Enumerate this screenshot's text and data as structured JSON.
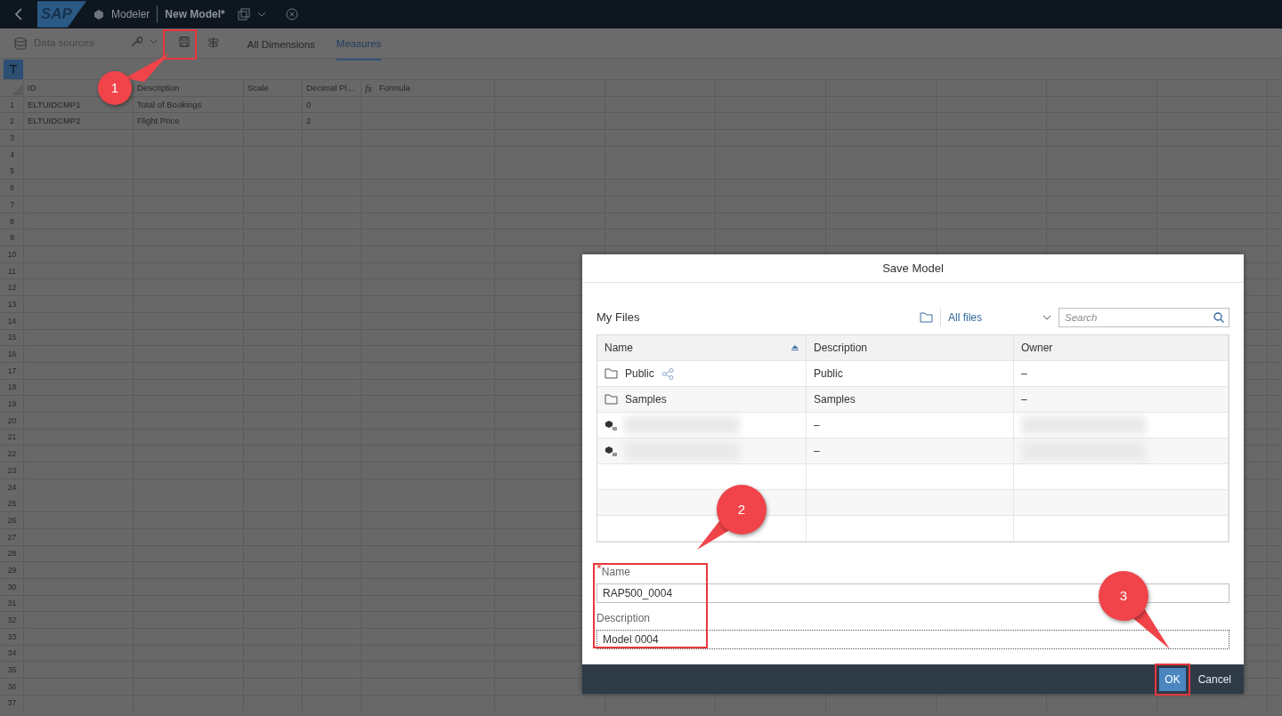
{
  "shell": {
    "logo": "SAP",
    "app": "Modeler",
    "document": "New Model*"
  },
  "toolbar": {
    "data_sources": {
      "label": "Data sources",
      "disabled": true
    },
    "tabs": [
      {
        "label": "All Dimensions",
        "selected": false
      },
      {
        "label": "Measures",
        "selected": true
      }
    ]
  },
  "grid": {
    "formula_button": "T",
    "formula_icon": "fx",
    "columns": [
      "ID",
      "Description",
      "Scale",
      "Decimal Pl...",
      "Formula"
    ],
    "rows": [
      {
        "number": "1",
        "id": "ELTUIDCMP1",
        "description": "Total of Bookings",
        "decimal_places": "0"
      },
      {
        "number": "2",
        "id": "ELTUIDCMP2",
        "description": "Flight Price",
        "decimal_places": "2"
      }
    ],
    "empty_row_numbers": [
      "3",
      "4",
      "5",
      "6",
      "7",
      "8",
      "9",
      "10",
      "11",
      "12",
      "13",
      "14",
      "15",
      "16",
      "17",
      "18",
      "19",
      "20",
      "21",
      "22",
      "23",
      "24",
      "25",
      "26",
      "27",
      "28",
      "29",
      "30",
      "31",
      "32",
      "33",
      "34",
      "35",
      "36",
      "37"
    ]
  },
  "dialog": {
    "title": "Save Model",
    "location": "My Files",
    "filter": "All files",
    "search": {
      "placeholder": "Search"
    },
    "columns": [
      "Name",
      "Description",
      "Owner"
    ],
    "files": [
      {
        "kind": "folder",
        "name": "Public",
        "shared": true,
        "description": "Public",
        "owner": "–"
      },
      {
        "kind": "folder",
        "name": "Samples",
        "shared": false,
        "description": "Samples",
        "owner": "–"
      },
      {
        "kind": "model",
        "description": "–"
      },
      {
        "kind": "model",
        "description": "–"
      }
    ],
    "name_field": {
      "label": "Name",
      "required": true,
      "required_mark": "*",
      "value": "RAP500_0004"
    },
    "description_field": {
      "label": "Description",
      "value": "Model 0004",
      "focused": true
    },
    "buttons": [
      {
        "label": "OK",
        "kind": "primary"
      },
      {
        "label": "Cancel",
        "kind": "plain"
      }
    ]
  },
  "callouts": [
    "1",
    "2",
    "3"
  ]
}
